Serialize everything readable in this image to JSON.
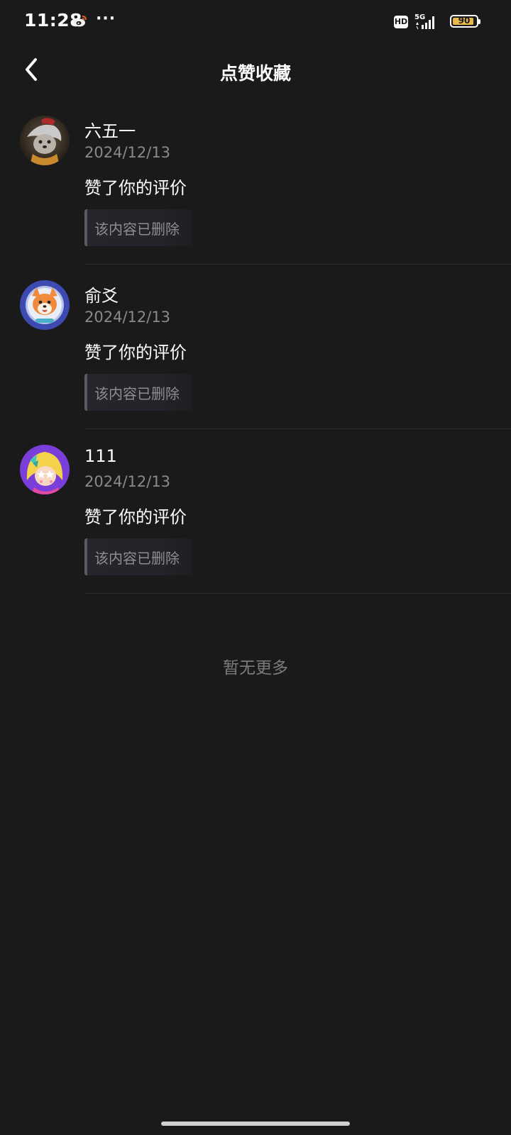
{
  "status_bar": {
    "time": "11:28",
    "dots": "···",
    "hd": "HD",
    "network": "5G",
    "battery_level": 0.9,
    "battery_text": "90"
  },
  "header": {
    "title": "点赞收藏",
    "back_icon": "chevron-left-icon"
  },
  "notifications": [
    {
      "username": "六五一",
      "date": "2024/12/13",
      "action": "赞了你的评价",
      "quoted": "该内容已删除",
      "avatar_icon": "avatar-dog-photo"
    },
    {
      "username": "俞爻",
      "date": "2024/12/13",
      "action": "赞了你的评价",
      "quoted": "该内容已删除",
      "avatar_icon": "avatar-shiba-cartoon"
    },
    {
      "username": "111",
      "date": "2024/12/13",
      "action": "赞了你的评价",
      "quoted": "该内容已删除",
      "avatar_icon": "avatar-anime-girl"
    }
  ],
  "footer": {
    "no_more": "暂无更多"
  },
  "colors": {
    "background": "#1a1a1a",
    "muted_text": "#8a8a8a",
    "battery": "#e8b84a"
  }
}
